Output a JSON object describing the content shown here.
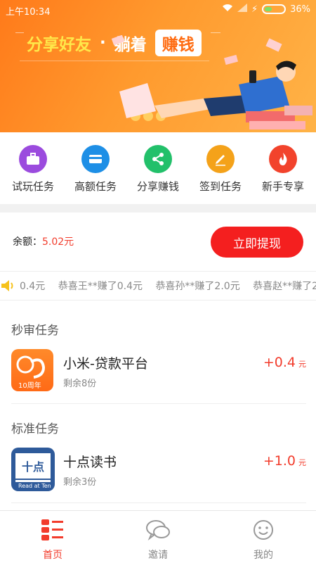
{
  "status_bar": {
    "time": "上午10:34",
    "battery": "36%"
  },
  "banner": {
    "part1": "分享好友",
    "dot": "·",
    "part2": "躺着",
    "part3": "赚钱"
  },
  "shortcuts": [
    {
      "label": "试玩任务",
      "icon": "briefcase-icon",
      "color": "#9b4bde"
    },
    {
      "label": "高额任务",
      "icon": "card-icon",
      "color": "#1e8fe6"
    },
    {
      "label": "分享赚钱",
      "icon": "share-icon",
      "color": "#22c06a"
    },
    {
      "label": "签到任务",
      "icon": "pencil-icon",
      "color": "#f4a21a"
    },
    {
      "label": "新手专享",
      "icon": "flame-icon",
      "color": "#f2432c"
    }
  ],
  "balance": {
    "label": "余额：",
    "value": "5.02元",
    "withdraw_label": "立即提现"
  },
  "ticker": {
    "items": [
      "0.4元",
      "恭喜王**赚了0.4元",
      "恭喜孙**赚了2.0元",
      "恭喜赵**赚了2"
    ]
  },
  "sections": {
    "quick": {
      "title": "秒审任务",
      "task": {
        "name": "小米-贷款平台",
        "remain": "剩余8份",
        "reward": "+0.4",
        "unit": "元",
        "badge": "10周年"
      }
    },
    "standard": {
      "title": "标准任务",
      "task": {
        "name": "十点读书",
        "remain": "剩余3份",
        "reward": "+1.0",
        "unit": "元",
        "logo_caption": "Read at Ten"
      }
    }
  },
  "nav": [
    {
      "label": "首页",
      "icon": "home-grid-icon",
      "active": true
    },
    {
      "label": "邀请",
      "icon": "chat-bubbles-icon",
      "active": false
    },
    {
      "label": "我的",
      "icon": "smiley-icon",
      "active": false
    }
  ],
  "colors": {
    "accent": "#f23c2c",
    "banner": "#ff8a24"
  }
}
